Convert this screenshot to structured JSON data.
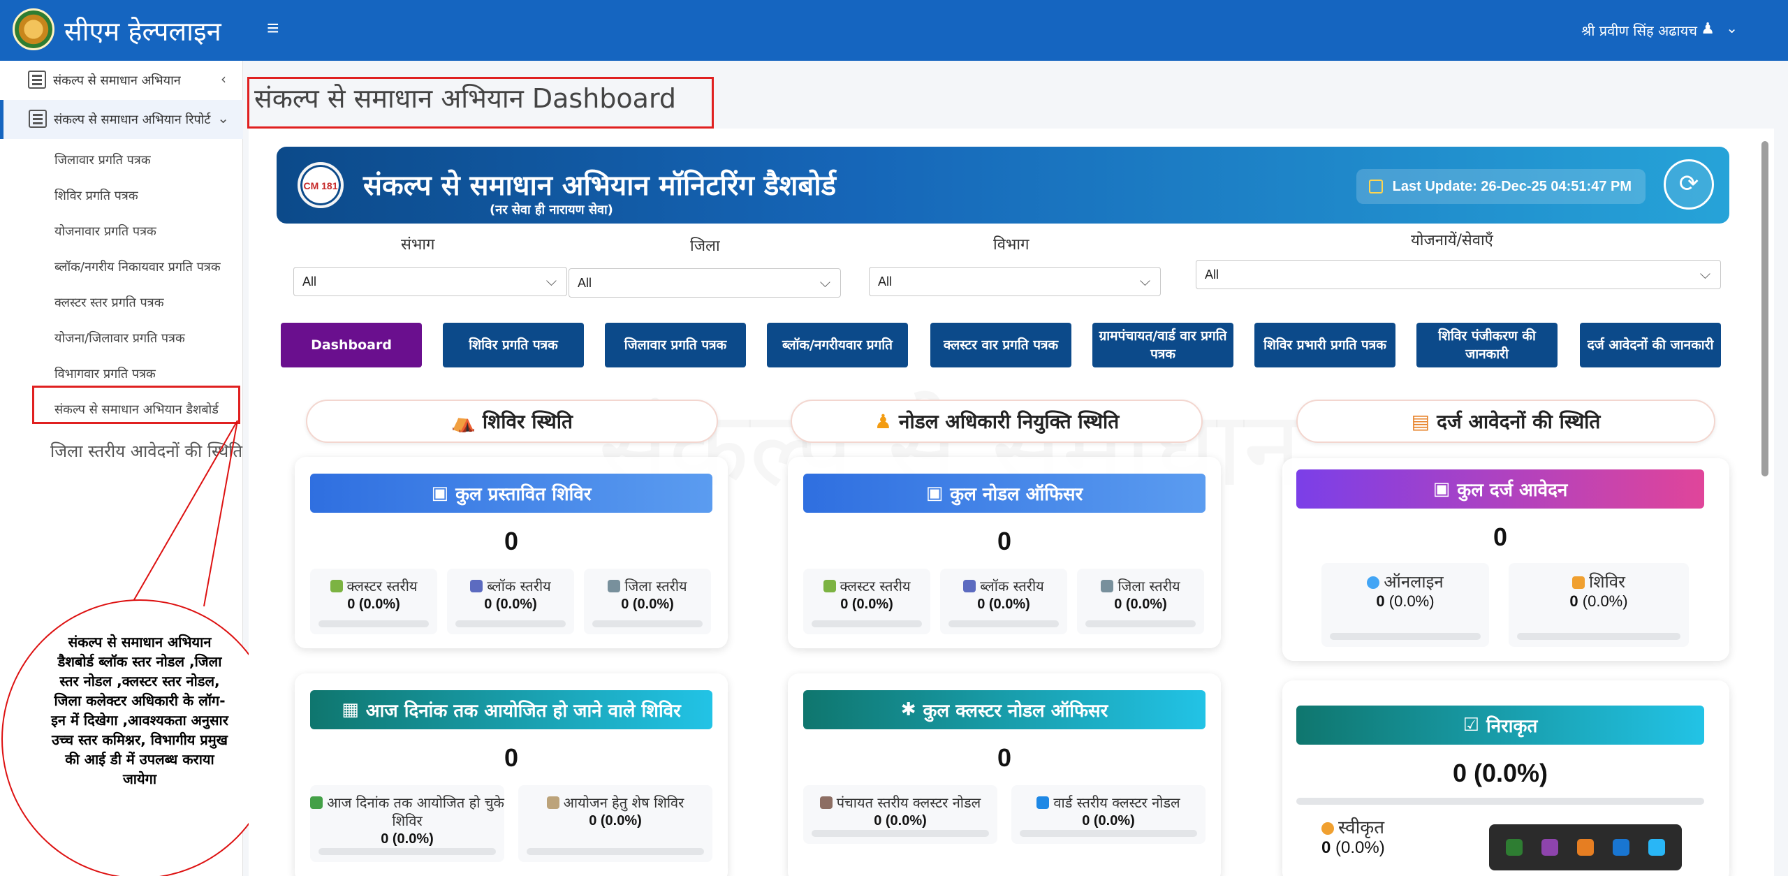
{
  "header": {
    "brand": "सीएम हेल्पलाइन",
    "menu_icon": "hamburger-icon",
    "user_name": "श्री प्रवीण सिंह अढायच"
  },
  "sidebar": {
    "main_items": [
      "संकल्प से समाधान अभियान",
      "संकल्प से समाधान अभियान रिपोर्ट"
    ],
    "sub_items": [
      "जिलावार प्रगति पत्रक",
      "शिविर प्रगति पत्रक",
      "योजनावार प्रगति पत्रक",
      "ब्लॉक/नगरीय निकायवार प्रगति पत्रक",
      "क्लस्टर स्तर प्रगति पत्रक",
      "योजना/जिलावार प्रगति पत्रक",
      "विभागवार प्रगति पत्रक",
      "संकल्प से समाधान अभियान डैशबोर्ड"
    ],
    "level_item": "जिला स्तरीय आवेदनों की स्थिति"
  },
  "callout": "संकल्प से समाधान अभियान डैशबोर्ड ब्लॉक स्तर नोडल ,जिला स्तर नोडल ,क्लस्टर स्तर नोडल, जिला कलेक्टर अधिकारी के लॉग-इन में दिखेगा ,आवश्यकता अनुसार उच्च स्तर कमिश्नर, विभागीय प्रमुख की आई डी में उपलब्ध कराया जायेगा",
  "page_title": "संकल्प से समाधान अभियान Dashboard",
  "banner": {
    "logo_text": "CM 181",
    "title": "संकल्प से समाधान अभियान मॉनिटरिंग डैशबोर्ड",
    "subtitle": "(नर सेवा ही नारायण सेवा)",
    "last_update": "Last Update: 26-Dec-25 04:51:47 PM"
  },
  "filters": [
    {
      "label": "संभाग",
      "value": "All"
    },
    {
      "label": "जिला",
      "value": "All"
    },
    {
      "label": "विभाग",
      "value": "All"
    },
    {
      "label": "योजनायें/सेवाएँ",
      "value": "All"
    }
  ],
  "tabs": [
    "Dashboard",
    "शिविर प्रगति पत्रक",
    "जिलावार प्रगति पत्रक",
    "ब्लॉक/नगरीयवार प्रगति",
    "क्लस्टर वार प्रगति पत्रक",
    "ग्रामपंचायत/वार्ड वार प्रगति पत्रक",
    "शिविर प्रभारी प्रगति पत्रक",
    "शिविर पंजीकरण की जानकारी",
    "दर्ज आवेदनों की जानकारी"
  ],
  "sections": {
    "camp": {
      "title": "शिविर स्थिति",
      "card1": {
        "title": "कुल प्रस्तावित शिविर",
        "total": "0",
        "items": [
          {
            "label": "क्लस्टर स्तरीय",
            "value": "0 (0.0%)"
          },
          {
            "label": "ब्लॉक स्तरीय",
            "value": "0 (0.0%)"
          },
          {
            "label": "जिला स्तरीय",
            "value": "0 (0.0%)"
          }
        ]
      },
      "card2": {
        "title": "आज दिनांक तक आयोजित हो जाने वाले शिविर",
        "total": "0",
        "items": [
          {
            "label": "आज दिनांक तक आयोजित हो चुके शिविर",
            "value": "0 (0.0%)"
          },
          {
            "label": "आयोजन हेतु शेष शिविर",
            "value": "0 (0.0%)"
          }
        ]
      }
    },
    "nodal": {
      "title": "नोडल अधिकारी नियुक्ति स्थिति",
      "card1": {
        "title": "कुल नोडल ऑफिसर",
        "total": "0",
        "items": [
          {
            "label": "क्लस्टर स्तरीय",
            "value": "0 (0.0%)"
          },
          {
            "label": "ब्लॉक स्तरीय",
            "value": "0 (0.0%)"
          },
          {
            "label": "जिला स्तरीय",
            "value": "0 (0.0%)"
          }
        ]
      },
      "card2": {
        "title": "कुल क्लस्टर नोडल ऑफिसर",
        "total": "0",
        "items": [
          {
            "label": "पंचायत स्तरीय क्लस्टर नोडल",
            "value": "0 (0.0%)"
          },
          {
            "label": "वार्ड स्तरीय क्लस्टर नोडल",
            "value": "0 (0.0%)"
          }
        ]
      }
    },
    "applications": {
      "title": "दर्ज आवेदनों की स्थिति",
      "card1": {
        "title": "कुल दर्ज आवेदन",
        "total": "0",
        "items": [
          {
            "label": "ऑनलाइन",
            "value": "0",
            "pct": " (0.0%)"
          },
          {
            "label": "शिविर",
            "value": "0",
            "pct": " (0.0%)"
          }
        ]
      },
      "card2": {
        "title": "निराकृत",
        "total": "0 (0.0%)",
        "items": [
          {
            "label": "स्वीकृत",
            "value": "0",
            "pct": " (0.0%)"
          }
        ]
      }
    }
  },
  "colors": {
    "header": "#1565c0",
    "tab": "#0c4a8a",
    "tab_active": "#6a0f8e",
    "highlight": "#e02020"
  }
}
